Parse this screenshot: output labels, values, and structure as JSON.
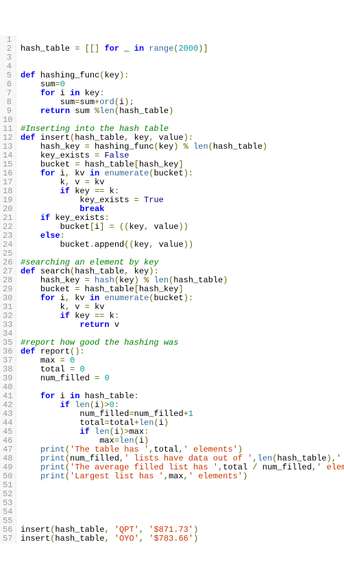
{
  "lines": [
    {
      "n": 1,
      "tokens": []
    },
    {
      "n": 2,
      "indent": 0,
      "tokens": [
        [
          "nm",
          "hash_table "
        ],
        [
          "op",
          "="
        ],
        [
          "nm",
          " "
        ],
        [
          "pn",
          "[[]"
        ],
        [
          "nm",
          " "
        ],
        [
          "kw",
          "for"
        ],
        [
          "nm",
          " _ "
        ],
        [
          "kw",
          "in"
        ],
        [
          "nm",
          " "
        ],
        [
          "bi",
          "range"
        ],
        [
          "pn",
          "("
        ],
        [
          "num",
          "2000"
        ],
        [
          "pn",
          ")]"
        ]
      ]
    },
    {
      "n": 3,
      "tokens": []
    },
    {
      "n": 4,
      "tokens": []
    },
    {
      "n": 5,
      "indent": 0,
      "tokens": [
        [
          "kw",
          "def"
        ],
        [
          "nm",
          " "
        ],
        [
          "fn",
          "hashing_func"
        ],
        [
          "pn",
          "("
        ],
        [
          "nm",
          "key"
        ],
        [
          "pn",
          "):"
        ]
      ]
    },
    {
      "n": 6,
      "indent": 1,
      "tokens": [
        [
          "nm",
          "sum"
        ],
        [
          "op",
          "="
        ],
        [
          "num",
          "0"
        ]
      ]
    },
    {
      "n": 7,
      "indent": 1,
      "tokens": [
        [
          "kw",
          "for"
        ],
        [
          "nm",
          " i "
        ],
        [
          "kw",
          "in"
        ],
        [
          "nm",
          " key"
        ],
        [
          "pn",
          ":"
        ]
      ]
    },
    {
      "n": 8,
      "indent": 2,
      "tokens": [
        [
          "nm",
          "sum"
        ],
        [
          "op",
          "="
        ],
        [
          "nm",
          "sum"
        ],
        [
          "op",
          "+"
        ],
        [
          "bi",
          "ord"
        ],
        [
          "pn",
          "("
        ],
        [
          "nm",
          "i"
        ],
        [
          "pn",
          ");"
        ]
      ]
    },
    {
      "n": 9,
      "indent": 1,
      "tokens": [
        [
          "kw",
          "return"
        ],
        [
          "nm",
          " sum "
        ],
        [
          "op",
          "%"
        ],
        [
          "bi",
          "len"
        ],
        [
          "pn",
          "("
        ],
        [
          "nm",
          "hash_table"
        ],
        [
          "pn",
          ")"
        ]
      ]
    },
    {
      "n": 10,
      "tokens": []
    },
    {
      "n": 11,
      "indent": 0,
      "tokens": [
        [
          "cm",
          "#Inserting into the hash table"
        ]
      ]
    },
    {
      "n": 12,
      "indent": 0,
      "tokens": [
        [
          "kw",
          "def"
        ],
        [
          "nm",
          " "
        ],
        [
          "fn",
          "insert"
        ],
        [
          "pn",
          "("
        ],
        [
          "nm",
          "hash_table"
        ],
        [
          "pn",
          ", "
        ],
        [
          "nm",
          "key"
        ],
        [
          "pn",
          ", "
        ],
        [
          "nm",
          "value"
        ],
        [
          "pn",
          "):"
        ]
      ]
    },
    {
      "n": 13,
      "indent": 1,
      "tokens": [
        [
          "nm",
          "hash_key "
        ],
        [
          "op",
          "="
        ],
        [
          "nm",
          " hashing_func"
        ],
        [
          "pn",
          "("
        ],
        [
          "nm",
          "key"
        ],
        [
          "pn",
          ")"
        ],
        [
          "nm",
          " "
        ],
        [
          "op",
          "%"
        ],
        [
          "nm",
          " "
        ],
        [
          "bi",
          "len"
        ],
        [
          "pn",
          "("
        ],
        [
          "nm",
          "hash_table"
        ],
        [
          "pn",
          ")"
        ]
      ]
    },
    {
      "n": 14,
      "indent": 1,
      "tokens": [
        [
          "nm",
          "key_exists "
        ],
        [
          "op",
          "="
        ],
        [
          "nm",
          " "
        ],
        [
          "bool",
          "False"
        ]
      ]
    },
    {
      "n": 15,
      "indent": 1,
      "tokens": [
        [
          "nm",
          "bucket "
        ],
        [
          "op",
          "="
        ],
        [
          "nm",
          " hash_table"
        ],
        [
          "pn",
          "["
        ],
        [
          "nm",
          "hash_key"
        ],
        [
          "pn",
          "]"
        ]
      ]
    },
    {
      "n": 16,
      "indent": 1,
      "tokens": [
        [
          "kw",
          "for"
        ],
        [
          "nm",
          " i"
        ],
        [
          "pn",
          ", "
        ],
        [
          "nm",
          "kv "
        ],
        [
          "kw",
          "in"
        ],
        [
          "nm",
          " "
        ],
        [
          "bi",
          "enumerate"
        ],
        [
          "pn",
          "("
        ],
        [
          "nm",
          "bucket"
        ],
        [
          "pn",
          "):"
        ]
      ]
    },
    {
      "n": 17,
      "indent": 2,
      "tokens": [
        [
          "nm",
          "k"
        ],
        [
          "pn",
          ", "
        ],
        [
          "nm",
          "v "
        ],
        [
          "op",
          "="
        ],
        [
          "nm",
          " kv"
        ]
      ]
    },
    {
      "n": 18,
      "indent": 2,
      "tokens": [
        [
          "kw",
          "if"
        ],
        [
          "nm",
          " key "
        ],
        [
          "op",
          "=="
        ],
        [
          "nm",
          " k"
        ],
        [
          "pn",
          ":"
        ]
      ]
    },
    {
      "n": 19,
      "indent": 3,
      "tokens": [
        [
          "nm",
          "key_exists "
        ],
        [
          "op",
          "="
        ],
        [
          "nm",
          " "
        ],
        [
          "bool",
          "True"
        ]
      ]
    },
    {
      "n": 20,
      "indent": 3,
      "tokens": [
        [
          "kw",
          "break"
        ]
      ]
    },
    {
      "n": 21,
      "indent": 1,
      "tokens": [
        [
          "kw",
          "if"
        ],
        [
          "nm",
          " key_exists"
        ],
        [
          "pn",
          ":"
        ]
      ]
    },
    {
      "n": 22,
      "indent": 2,
      "tokens": [
        [
          "nm",
          "bucket"
        ],
        [
          "pn",
          "["
        ],
        [
          "nm",
          "i"
        ],
        [
          "pn",
          "]"
        ],
        [
          "nm",
          " "
        ],
        [
          "op",
          "="
        ],
        [
          "nm",
          " "
        ],
        [
          "pn",
          "(("
        ],
        [
          "nm",
          "key"
        ],
        [
          "pn",
          ", "
        ],
        [
          "nm",
          "value"
        ],
        [
          "pn",
          "))"
        ]
      ]
    },
    {
      "n": 23,
      "indent": 1,
      "tokens": [
        [
          "kw",
          "else"
        ],
        [
          "pn",
          ":"
        ]
      ]
    },
    {
      "n": 24,
      "indent": 2,
      "tokens": [
        [
          "nm",
          "bucket"
        ],
        [
          "pn",
          "."
        ],
        [
          "nm",
          "append"
        ],
        [
          "pn",
          "(("
        ],
        [
          "nm",
          "key"
        ],
        [
          "pn",
          ", "
        ],
        [
          "nm",
          "value"
        ],
        [
          "pn",
          "))"
        ]
      ]
    },
    {
      "n": 25,
      "tokens": []
    },
    {
      "n": 26,
      "indent": 0,
      "tokens": [
        [
          "cm",
          "#searching an element by key"
        ]
      ]
    },
    {
      "n": 27,
      "indent": 0,
      "tokens": [
        [
          "kw",
          "def"
        ],
        [
          "nm",
          " "
        ],
        [
          "fn",
          "search"
        ],
        [
          "pn",
          "("
        ],
        [
          "nm",
          "hash_table"
        ],
        [
          "pn",
          ", "
        ],
        [
          "nm",
          "key"
        ],
        [
          "pn",
          "):"
        ]
      ]
    },
    {
      "n": 28,
      "indent": 1,
      "tokens": [
        [
          "nm",
          "hash_key "
        ],
        [
          "op",
          "="
        ],
        [
          "nm",
          " "
        ],
        [
          "bi",
          "hash"
        ],
        [
          "pn",
          "("
        ],
        [
          "nm",
          "key"
        ],
        [
          "pn",
          ")"
        ],
        [
          "nm",
          " "
        ],
        [
          "op",
          "%"
        ],
        [
          "nm",
          " "
        ],
        [
          "bi",
          "len"
        ],
        [
          "pn",
          "("
        ],
        [
          "nm",
          "hash_table"
        ],
        [
          "pn",
          ")"
        ]
      ]
    },
    {
      "n": 29,
      "indent": 1,
      "tokens": [
        [
          "nm",
          "bucket "
        ],
        [
          "op",
          "="
        ],
        [
          "nm",
          " hash_table"
        ],
        [
          "pn",
          "["
        ],
        [
          "nm",
          "hash_key"
        ],
        [
          "pn",
          "]"
        ]
      ]
    },
    {
      "n": 30,
      "indent": 1,
      "tokens": [
        [
          "kw",
          "for"
        ],
        [
          "nm",
          " i"
        ],
        [
          "pn",
          ", "
        ],
        [
          "nm",
          "kv "
        ],
        [
          "kw",
          "in"
        ],
        [
          "nm",
          " "
        ],
        [
          "bi",
          "enumerate"
        ],
        [
          "pn",
          "("
        ],
        [
          "nm",
          "bucket"
        ],
        [
          "pn",
          "):"
        ]
      ]
    },
    {
      "n": 31,
      "indent": 2,
      "tokens": [
        [
          "nm",
          "k"
        ],
        [
          "pn",
          ", "
        ],
        [
          "nm",
          "v "
        ],
        [
          "op",
          "="
        ],
        [
          "nm",
          " kv"
        ]
      ]
    },
    {
      "n": 32,
      "indent": 2,
      "tokens": [
        [
          "kw",
          "if"
        ],
        [
          "nm",
          " key "
        ],
        [
          "op",
          "=="
        ],
        [
          "nm",
          " k"
        ],
        [
          "pn",
          ":"
        ]
      ]
    },
    {
      "n": 33,
      "indent": 3,
      "tokens": [
        [
          "kw",
          "return"
        ],
        [
          "nm",
          " v"
        ]
      ]
    },
    {
      "n": 34,
      "tokens": []
    },
    {
      "n": 35,
      "indent": 0,
      "tokens": [
        [
          "cm",
          "#report how good the hashing was"
        ]
      ]
    },
    {
      "n": 36,
      "indent": 0,
      "tokens": [
        [
          "kw",
          "def"
        ],
        [
          "nm",
          " "
        ],
        [
          "fn",
          "report"
        ],
        [
          "pn",
          "():"
        ]
      ]
    },
    {
      "n": 37,
      "indent": 1,
      "tokens": [
        [
          "nm",
          "max "
        ],
        [
          "op",
          "="
        ],
        [
          "nm",
          " "
        ],
        [
          "num",
          "0"
        ]
      ]
    },
    {
      "n": 38,
      "indent": 1,
      "tokens": [
        [
          "nm",
          "total "
        ],
        [
          "op",
          "="
        ],
        [
          "nm",
          " "
        ],
        [
          "num",
          "0"
        ]
      ]
    },
    {
      "n": 39,
      "indent": 1,
      "tokens": [
        [
          "nm",
          "num_filled "
        ],
        [
          "op",
          "="
        ],
        [
          "nm",
          " "
        ],
        [
          "num",
          "0"
        ]
      ]
    },
    {
      "n": 40,
      "tokens": []
    },
    {
      "n": 41,
      "indent": 1,
      "tokens": [
        [
          "kw",
          "for"
        ],
        [
          "nm",
          " i "
        ],
        [
          "kw",
          "in"
        ],
        [
          "nm",
          " hash_table"
        ],
        [
          "pn",
          ":"
        ]
      ]
    },
    {
      "n": 42,
      "indent": 2,
      "tokens": [
        [
          "kw",
          "if"
        ],
        [
          "nm",
          " "
        ],
        [
          "bi",
          "len"
        ],
        [
          "pn",
          "("
        ],
        [
          "nm",
          "i"
        ],
        [
          "pn",
          ")"
        ],
        [
          "op",
          ">"
        ],
        [
          "num",
          "0"
        ],
        [
          "pn",
          ":"
        ]
      ]
    },
    {
      "n": 43,
      "indent": 3,
      "tokens": [
        [
          "nm",
          "num_filled"
        ],
        [
          "op",
          "="
        ],
        [
          "nm",
          "num_filled"
        ],
        [
          "op",
          "+"
        ],
        [
          "num",
          "1"
        ]
      ]
    },
    {
      "n": 44,
      "indent": 3,
      "tokens": [
        [
          "nm",
          "total"
        ],
        [
          "op",
          "="
        ],
        [
          "nm",
          "total"
        ],
        [
          "op",
          "+"
        ],
        [
          "bi",
          "len"
        ],
        [
          "pn",
          "("
        ],
        [
          "nm",
          "i"
        ],
        [
          "pn",
          ")"
        ]
      ]
    },
    {
      "n": 45,
      "indent": 3,
      "tokens": [
        [
          "kw",
          "if"
        ],
        [
          "nm",
          " "
        ],
        [
          "bi",
          "len"
        ],
        [
          "pn",
          "("
        ],
        [
          "nm",
          "i"
        ],
        [
          "pn",
          ")"
        ],
        [
          "op",
          ">"
        ],
        [
          "nm",
          "max"
        ],
        [
          "pn",
          ":"
        ]
      ]
    },
    {
      "n": 46,
      "indent": 4,
      "tokens": [
        [
          "nm",
          "max"
        ],
        [
          "op",
          "="
        ],
        [
          "bi",
          "len"
        ],
        [
          "pn",
          "("
        ],
        [
          "nm",
          "i"
        ],
        [
          "pn",
          ")"
        ]
      ]
    },
    {
      "n": 47,
      "indent": 1,
      "tokens": [
        [
          "bi",
          "print"
        ],
        [
          "pn",
          "("
        ],
        [
          "str",
          "'The table has '"
        ],
        [
          "pn",
          ","
        ],
        [
          "nm",
          "total"
        ],
        [
          "pn",
          ","
        ],
        [
          "str",
          "' elements'"
        ],
        [
          "pn",
          ")"
        ]
      ]
    },
    {
      "n": 48,
      "indent": 1,
      "tokens": [
        [
          "bi",
          "print"
        ],
        [
          "pn",
          "("
        ],
        [
          "nm",
          "num_filled"
        ],
        [
          "pn",
          ","
        ],
        [
          "str",
          "' lists have data out of '"
        ],
        [
          "pn",
          ","
        ],
        [
          "bi",
          "len"
        ],
        [
          "pn",
          "("
        ],
        [
          "nm",
          "hash_table"
        ],
        [
          "pn",
          "),"
        ],
        [
          "str",
          "' total'"
        ],
        [
          "pn",
          ")"
        ]
      ]
    },
    {
      "n": 49,
      "indent": 1,
      "tokens": [
        [
          "bi",
          "print"
        ],
        [
          "pn",
          "("
        ],
        [
          "str",
          "'The average filled list has '"
        ],
        [
          "pn",
          ","
        ],
        [
          "nm",
          "total "
        ],
        [
          "op",
          "/"
        ],
        [
          "nm",
          " num_filled"
        ],
        [
          "pn",
          ","
        ],
        [
          "str",
          "' elements'"
        ],
        [
          "pn",
          ")"
        ]
      ]
    },
    {
      "n": 50,
      "indent": 1,
      "tokens": [
        [
          "bi",
          "print"
        ],
        [
          "pn",
          "("
        ],
        [
          "str",
          "'Largest list has '"
        ],
        [
          "pn",
          ","
        ],
        [
          "nm",
          "max"
        ],
        [
          "pn",
          ","
        ],
        [
          "str",
          "' elements'"
        ],
        [
          "pn",
          ")"
        ]
      ]
    },
    {
      "n": 51,
      "tokens": []
    },
    {
      "n": 52,
      "tokens": []
    },
    {
      "n": 53,
      "tokens": []
    },
    {
      "n": 54,
      "tokens": []
    },
    {
      "n": 55,
      "tokens": []
    },
    {
      "n": 56,
      "indent": 0,
      "tokens": [
        [
          "nm",
          "insert"
        ],
        [
          "pn",
          "("
        ],
        [
          "nm",
          "hash_table"
        ],
        [
          "pn",
          ", "
        ],
        [
          "str",
          "'QPT'"
        ],
        [
          "pn",
          ", "
        ],
        [
          "str",
          "'$871.73'"
        ],
        [
          "pn",
          ")"
        ]
      ]
    },
    {
      "n": 57,
      "indent": 0,
      "tokens": [
        [
          "nm",
          "insert"
        ],
        [
          "pn",
          "("
        ],
        [
          "nm",
          "hash_table"
        ],
        [
          "pn",
          ", "
        ],
        [
          "str",
          "'OYO'"
        ],
        [
          "pn",
          ", "
        ],
        [
          "str",
          "'$783.66'"
        ],
        [
          "pn",
          ")"
        ]
      ]
    }
  ],
  "indent_unit": "    "
}
